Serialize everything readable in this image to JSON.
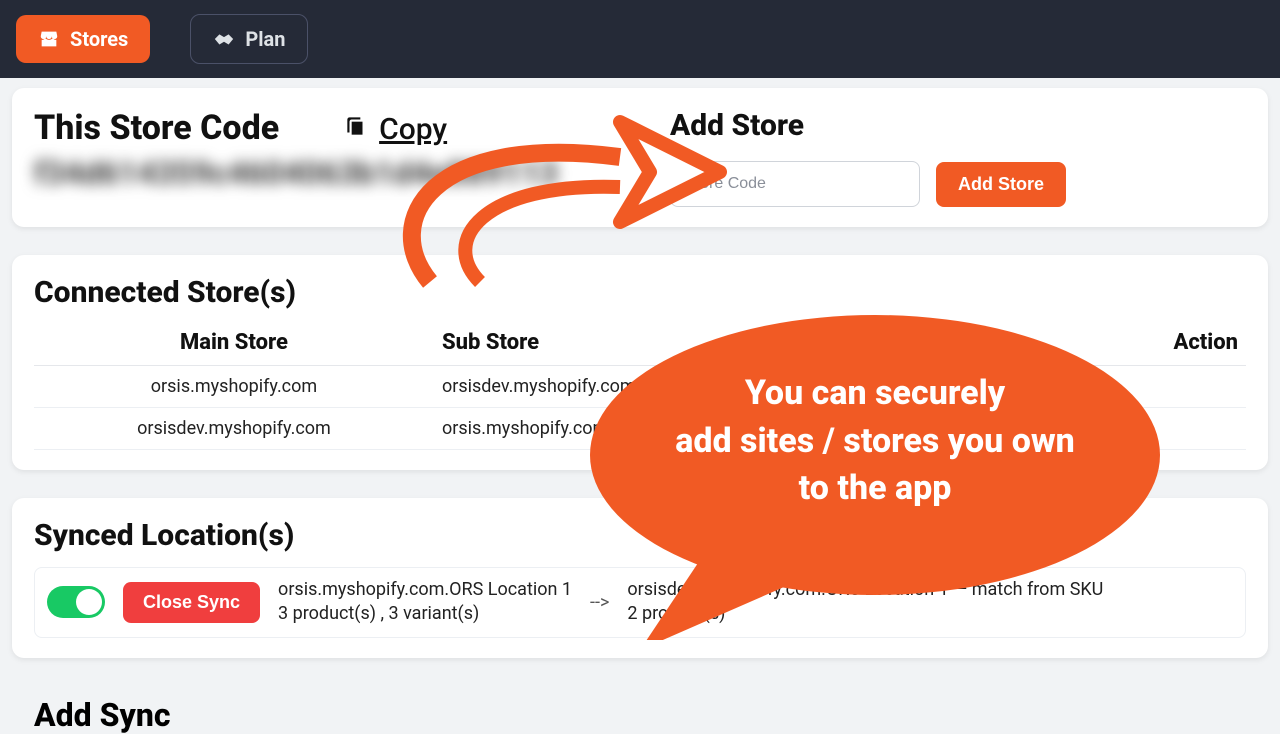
{
  "nav": {
    "stores_label": "Stores",
    "plan_label": "Plan"
  },
  "store_code": {
    "title": "This Store Code",
    "copy_label": "Copy",
    "masked_value": "f34d614359c4604063b1d4e889113"
  },
  "add_store": {
    "title": "Add Store",
    "placeholder": "Store Code",
    "button_label": "Add Store"
  },
  "connected": {
    "title": "Connected Store(s)",
    "columns": {
      "main": "Main Store",
      "sub": "Sub Store",
      "action": "Action"
    },
    "rows": [
      {
        "main": "orsis.myshopify.com",
        "sub": "orsisdev.myshopify.com"
      },
      {
        "main": "orsisdev.myshopify.com",
        "sub": "orsis.myshopify.com"
      }
    ]
  },
  "synced": {
    "title": "Synced Location(s)",
    "close_label": "Close Sync",
    "left_line1": "orsis.myshopify.com.ORS Location 1",
    "left_line2": "3 product(s) , 3 variant(s)",
    "sep": "-->",
    "right_line1": "orsisdev.myshopify.com.ORS Location 1 — match from SKU",
    "right_line2": "2 product(s)"
  },
  "add_sync": {
    "title": "Add Sync"
  },
  "tooltip": {
    "line1": "You can securely",
    "line2": "add sites / stores you own",
    "line3": "to the app"
  },
  "colors": {
    "accent": "#f15a24"
  }
}
